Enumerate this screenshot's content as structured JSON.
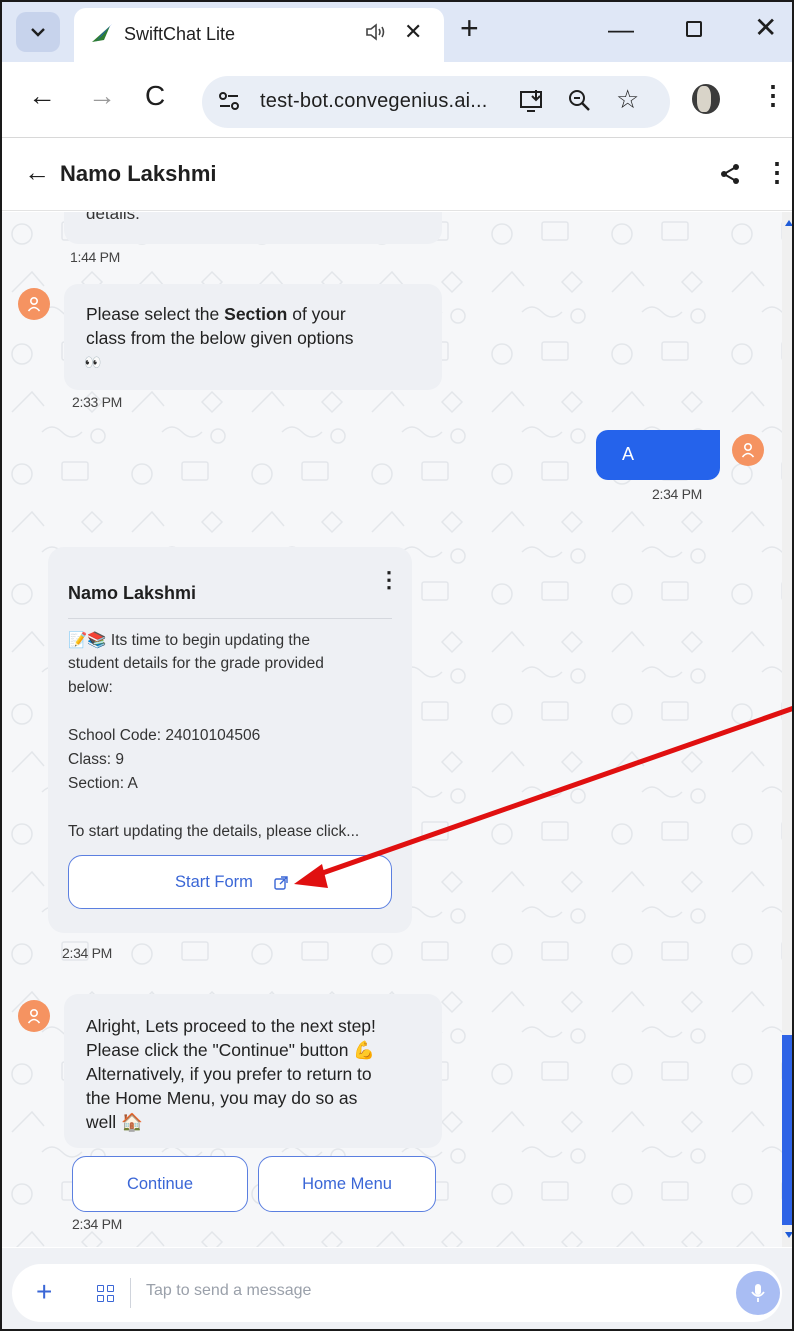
{
  "browser": {
    "tab_title": "SwiftChat Lite",
    "url": "test-bot.convegenius.ai...",
    "tab_close": "✕",
    "new_tab": "+",
    "minimize": "—",
    "close": "✕"
  },
  "header": {
    "back_arrow": "←",
    "title": "Namo Lakshmi",
    "menu": "⋮"
  },
  "messages": {
    "top_partial": "details.",
    "top_time": "1:44 PM",
    "section_prompt_prefix": "Please select the ",
    "section_prompt_bold": "Section",
    "section_prompt_suffix": " of your",
    "section_prompt_line2": "class from the below given options",
    "section_prompt_emoji": "👀",
    "section_prompt_time": "2:33 PM",
    "user_reply": "A",
    "user_reply_time": "2:34 PM",
    "card": {
      "title": "Namo Lakshmi",
      "menu": "⋮",
      "line1": "📝📚 Its time to begin updating the",
      "line2": "student details for the grade provided",
      "line3": "below:",
      "school_code": "School Code: 24010104506",
      "class": "Class: 9",
      "section": "Section: A",
      "start_hint": "To start updating the details, please click...",
      "button_label": "Start Form",
      "button_icon": "external-link-icon",
      "time": "2:34 PM"
    },
    "proceed": {
      "line1": "Alright, Lets proceed to the next step!",
      "line2": "Please click the \"Continue\" button 💪",
      "line3": "Alternatively, if you prefer to return to",
      "line4": "the Home Menu, you may do so as",
      "line5": "well 🏠",
      "continue_label": "Continue",
      "home_label": "Home Menu",
      "time": "2:34 PM"
    }
  },
  "composer": {
    "plus": "+",
    "placeholder": "Tap to send a message"
  },
  "annotation": {
    "arrow_color": "#e01010"
  },
  "colors": {
    "accent": "#2563eb",
    "avatar": "#f59361",
    "bubble": "#eef0f4"
  }
}
